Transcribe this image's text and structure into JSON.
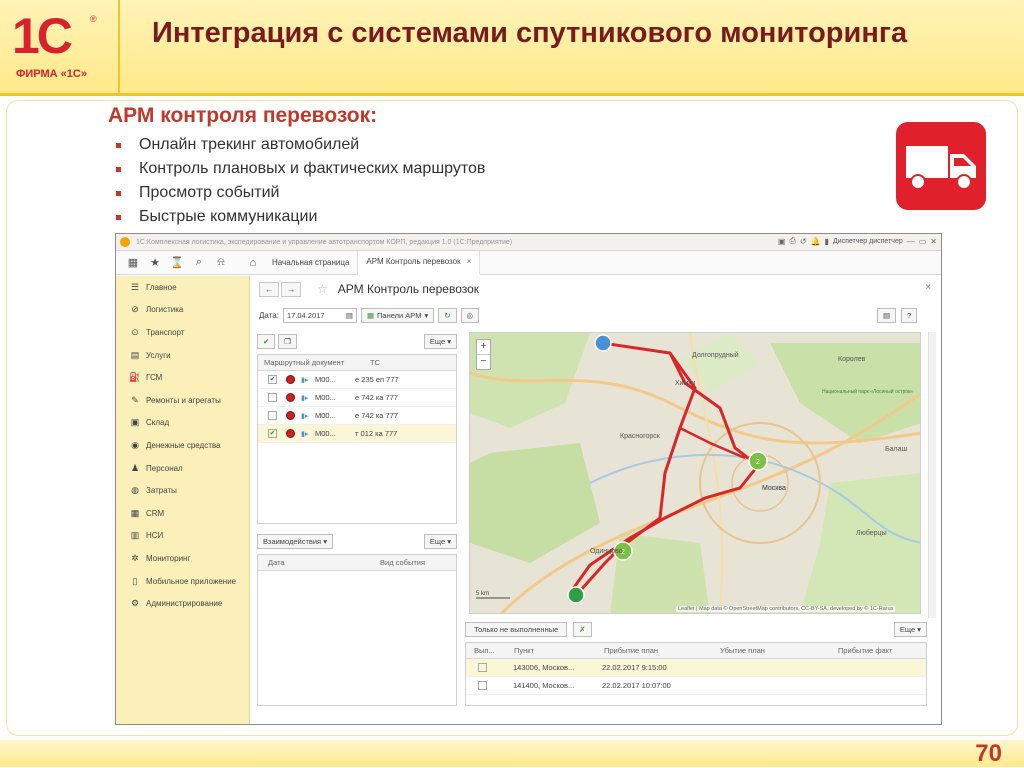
{
  "slide": {
    "logo_text": "1С",
    "logo_reg": "®",
    "logo_firm": "ФИРМА «1С»",
    "title": "Интеграция с системами спутникового мониторинга",
    "subhead": "АРМ контроля перевозок:",
    "bullets": [
      "Онлайн трекинг автомобилей",
      "Контроль плановых и фактических маршрутов",
      "Просмотр событий",
      "Быстрые коммуникации"
    ],
    "page_number": "70",
    "icon": "truck-icon",
    "accent_color": "#c0392b",
    "badge_color": "#e0202b"
  },
  "app": {
    "window_title": "1С:Комплексная логистика, экспедирование и управление автотранспортом КОРП, редакция 1.0 (1С:Предприятие)",
    "user": "Диспетчер диспетчер",
    "tabs": [
      {
        "label": "Начальная страница"
      },
      {
        "label": "АРМ Контроль перевозок"
      }
    ],
    "sidebar": [
      {
        "label": "Главное",
        "icon": "menu-icon",
        "glyph": "☰"
      },
      {
        "label": "Логистика",
        "icon": "logistics-icon",
        "glyph": "⊘"
      },
      {
        "label": "Транспорт",
        "icon": "transport-icon",
        "glyph": "⊙"
      },
      {
        "label": "Услуги",
        "icon": "services-icon",
        "glyph": "▤"
      },
      {
        "label": "ГСМ",
        "icon": "fuel-icon",
        "glyph": "⛽"
      },
      {
        "label": "Ремонты и агрегаты",
        "icon": "repair-icon",
        "glyph": "✎"
      },
      {
        "label": "Склад",
        "icon": "warehouse-icon",
        "glyph": "▣"
      },
      {
        "label": "Денежные средства",
        "icon": "money-icon",
        "glyph": "◉"
      },
      {
        "label": "Персонал",
        "icon": "staff-icon",
        "glyph": "♟"
      },
      {
        "label": "Затраты",
        "icon": "costs-icon",
        "glyph": "◍"
      },
      {
        "label": "CRM",
        "icon": "crm-icon",
        "glyph": "▦"
      },
      {
        "label": "НСИ",
        "icon": "reference-icon",
        "glyph": "▥"
      },
      {
        "label": "Мониторинг",
        "icon": "monitoring-icon",
        "glyph": "✲"
      },
      {
        "label": "Мобильное приложение",
        "icon": "mobile-icon",
        "glyph": "▯"
      },
      {
        "label": "Администрирование",
        "icon": "admin-icon",
        "glyph": "⚙"
      }
    ],
    "form": {
      "title": "АРМ Контроль перевозок",
      "date_label": "Дата:",
      "date_value": "17.04.2017",
      "panels_button": "Панели АРМ",
      "more_label": "Еще"
    },
    "routes": {
      "columns": [
        "Маршрутный документ",
        "ТС"
      ],
      "rows": [
        {
          "checked": true,
          "doc": "М00...",
          "vehicle": "е 235 еп 777"
        },
        {
          "checked": false,
          "doc": "М00...",
          "vehicle": "е 742 ка 777"
        },
        {
          "checked": false,
          "doc": "М00...",
          "vehicle": "е 742 ка 777"
        },
        {
          "checked": true,
          "doc": "М00...",
          "vehicle": "т 012 ка 777"
        }
      ]
    },
    "events": {
      "filter": "Взаимодействия",
      "columns": [
        "Дата",
        "Вид события"
      ]
    },
    "points": {
      "filter_button": "Только не выполненные",
      "columns": [
        "Вып...",
        "Пункт",
        "Прибытие план",
        "Убытие план",
        "Прибытие факт"
      ],
      "rows": [
        {
          "point": "143006, Москов...",
          "arrival": "22.02.2017 9:15:00"
        },
        {
          "point": "141400, Москов...",
          "arrival": "22.02.2017 10:07:00"
        }
      ]
    },
    "map": {
      "labels": [
        "Долгопрудный",
        "Королев",
        "Химки",
        "Красногорск",
        "Москва",
        "Балаш",
        "Люберцы",
        "Одинцово",
        "Национальный парк «Лосиный остров»"
      ],
      "clusters": [
        "2",
        "2"
      ],
      "scale": "5 km",
      "attribution": "Leaflet | Map data © OpenStreetMap contributors, CC-BY-SA, developed by © 1С-Rarus",
      "route_color": "#d92626",
      "cluster_color": "#7bc043"
    }
  }
}
